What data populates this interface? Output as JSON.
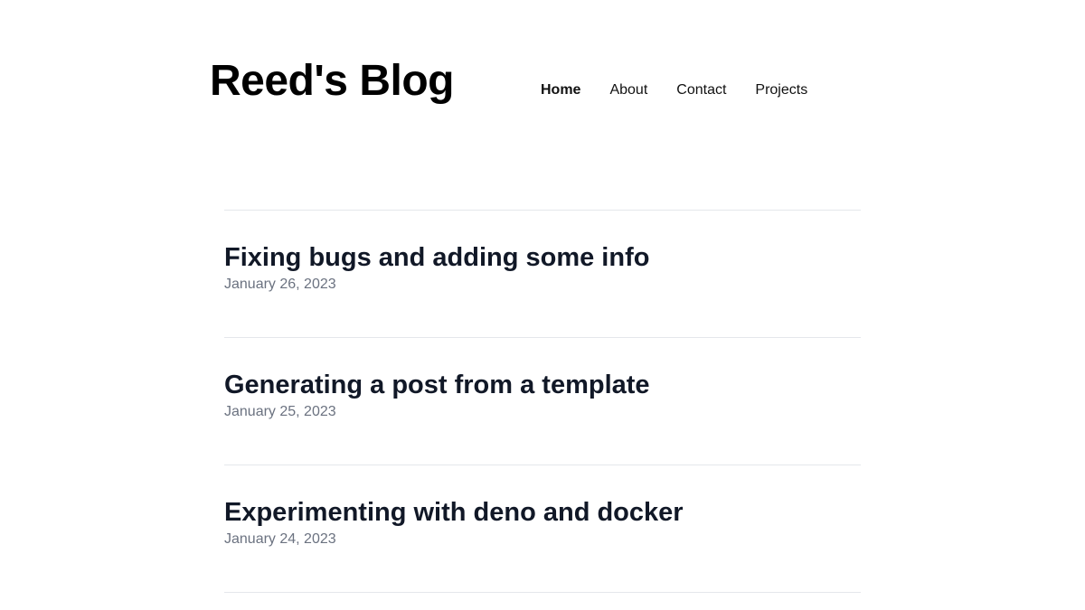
{
  "site": {
    "title": "Reed's Blog"
  },
  "nav": {
    "items": [
      {
        "label": "Home",
        "active": true
      },
      {
        "label": "About",
        "active": false
      },
      {
        "label": "Contact",
        "active": false
      },
      {
        "label": "Projects",
        "active": false
      }
    ]
  },
  "posts": [
    {
      "title": "Fixing bugs and adding some info",
      "date": "January 26, 2023"
    },
    {
      "title": "Generating a post from a template",
      "date": "January 25, 2023"
    },
    {
      "title": "Experimenting with deno and docker",
      "date": "January 24, 2023"
    }
  ],
  "colors": {
    "title": "#000000",
    "post_title": "#111827",
    "date": "#6b7280",
    "divider": "#e5e7eb"
  }
}
